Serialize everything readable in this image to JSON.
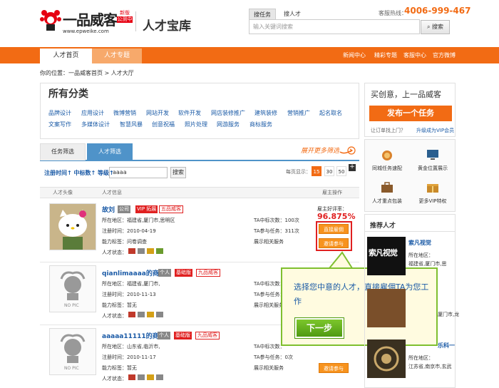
{
  "header": {
    "brand": "一品威客",
    "badge_line1": "新版",
    "badge_line2": "公测中",
    "url": "www.epweike.com",
    "page_title": "人才宝库",
    "search_tabs": [
      "搜任务",
      "搜人才"
    ],
    "search_placeholder": "输入关键词搜索",
    "search_button": "搜索",
    "hotline_label": "客服热线：",
    "hotline": "4006-999-467"
  },
  "nav": {
    "home": "人才首页",
    "topic": "人才专题",
    "right_links": [
      "新闻中心",
      "精彩专题",
      "客服中心",
      "官方微博"
    ]
  },
  "breadcrumb": "你的位置：一品威客首页 > 人才大厅",
  "categories": {
    "title": "所有分类",
    "row1": [
      "品牌设计",
      "应用设计",
      "微博营销",
      "网站开发",
      "软件开发",
      "网店装修推广",
      "建筑装修",
      "营销推广",
      "起名取名"
    ],
    "row2": [
      "文案写作",
      "多媒体设计",
      "智慧风暴",
      "创意祝福",
      "照片处理",
      "网游服务",
      "商标服务"
    ]
  },
  "filter": {
    "tab_task": "任务筛选",
    "tab_talent": "人才筛选",
    "hint": "展开更多筛选"
  },
  "search_row": {
    "sort_label": "注册时间↑ 中标数↑ 等级↑",
    "input_value": "aaaa",
    "button": "搜索",
    "perpage_label": "每页显示：",
    "perpage_options": [
      "15",
      "30",
      "50"
    ]
  },
  "list_header": {
    "avatar": "人才头像",
    "info": "人才信息",
    "ops": "雇主操作"
  },
  "talents": [
    {
      "name": "故刘",
      "tags": [
        "公司",
        "VIP 拓展",
        "五品威客"
      ],
      "region": "所在地区：福建省,厦门市,思明区",
      "reg_time": "注册时间：2010-04-19",
      "ability": "能力标签：问卷调查",
      "status": "人才状态：",
      "wins": "TA中标次数：100次",
      "joins": "TA参与任务：311次",
      "related": "展示相关服务",
      "rate_label": "雇主好评率：",
      "rate": "96.875%",
      "btn_hire": "直接雇佣",
      "btn_invite": "邀请参与"
    },
    {
      "name": "qianlimaaaa的商铺",
      "tags": [
        "个人",
        "基础版",
        "九品威客"
      ],
      "region": "所在地区：福建省,厦门市,",
      "reg_time": "注册时间：2010-11-13",
      "ability": "能力标签：暂无",
      "status": "人才状态：",
      "wins": "TA中标次数：",
      "joins": "TA参与任务：",
      "related": "展示相关服务",
      "nopic": "NO PIC"
    },
    {
      "name": "aaaaa11111的商铺",
      "tags": [
        "个人",
        "基础版",
        "九品威客"
      ],
      "region": "所在地区：山东省,临沂市,",
      "reg_time": "注册时间：2010-11-17",
      "ability": "能力标签：暂无",
      "status": "人才状态：",
      "wins": "TA中标次数：",
      "joins": "TA参与任务：0次",
      "related": "展示相关服务",
      "btn_invite": "邀请参与",
      "nopic": "NO PIC"
    }
  ],
  "tooltip": {
    "text": "选择您中意的人才，直接雇佣TA为您工作",
    "next": "下一步"
  },
  "right": {
    "buy_title": "买创意，上一品威客",
    "publish": "发布一个任务",
    "sub": "让订单找上门？",
    "vip": "升级成为VIP会员",
    "services": [
      "同城任务速配",
      "黄金位置展示",
      "人才重点包装",
      "更多VIP特权"
    ],
    "rec_title": "推荐人才",
    "rec": [
      {
        "name": "索凡视觉",
        "logo": "索凡视觉",
        "region_label": "所在地区：",
        "region": "福建省,厦门市,思"
      },
      {
        "name": "",
        "region": "厦门市,龙"
      },
      {
        "name": "乐科一",
        "region_label": "所在地区：",
        "region": "江苏省,南京市,玄武"
      }
    ]
  },
  "colors": {
    "accent": "#f26b14",
    "link": "#1a5aa6",
    "green": "#7fbf2f"
  }
}
